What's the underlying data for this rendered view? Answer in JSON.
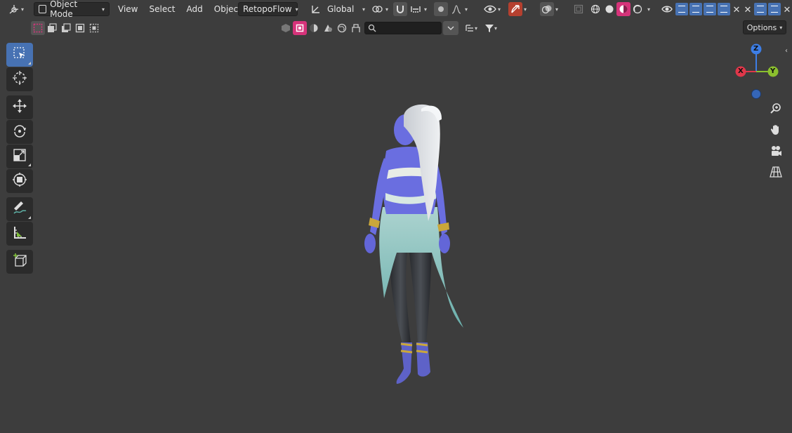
{
  "header": {
    "mode": "Object Mode",
    "menu": [
      "View",
      "Select",
      "Add",
      "Object"
    ],
    "addon_menu": "RetopoFlow",
    "transform_orientation": "Global"
  },
  "options_label": "Options",
  "search": {
    "placeholder": ""
  },
  "gizmo": {
    "x_label": "X",
    "y_label": "Y",
    "z_label": "Z"
  },
  "colors": {
    "viewport_bg": "#3d3d3d",
    "panel_bg": "#2b2b2b",
    "active_blue": "#4772b3",
    "axis_x": "#e0374a",
    "axis_y": "#8bc02e",
    "axis_z": "#3d7ee6",
    "select_pink": "#d6337a"
  },
  "tools": [
    "select-box",
    "cursor",
    "move",
    "rotate",
    "scale",
    "transform",
    "annotate",
    "measure",
    "add-cube"
  ],
  "viewport_object": "character model"
}
